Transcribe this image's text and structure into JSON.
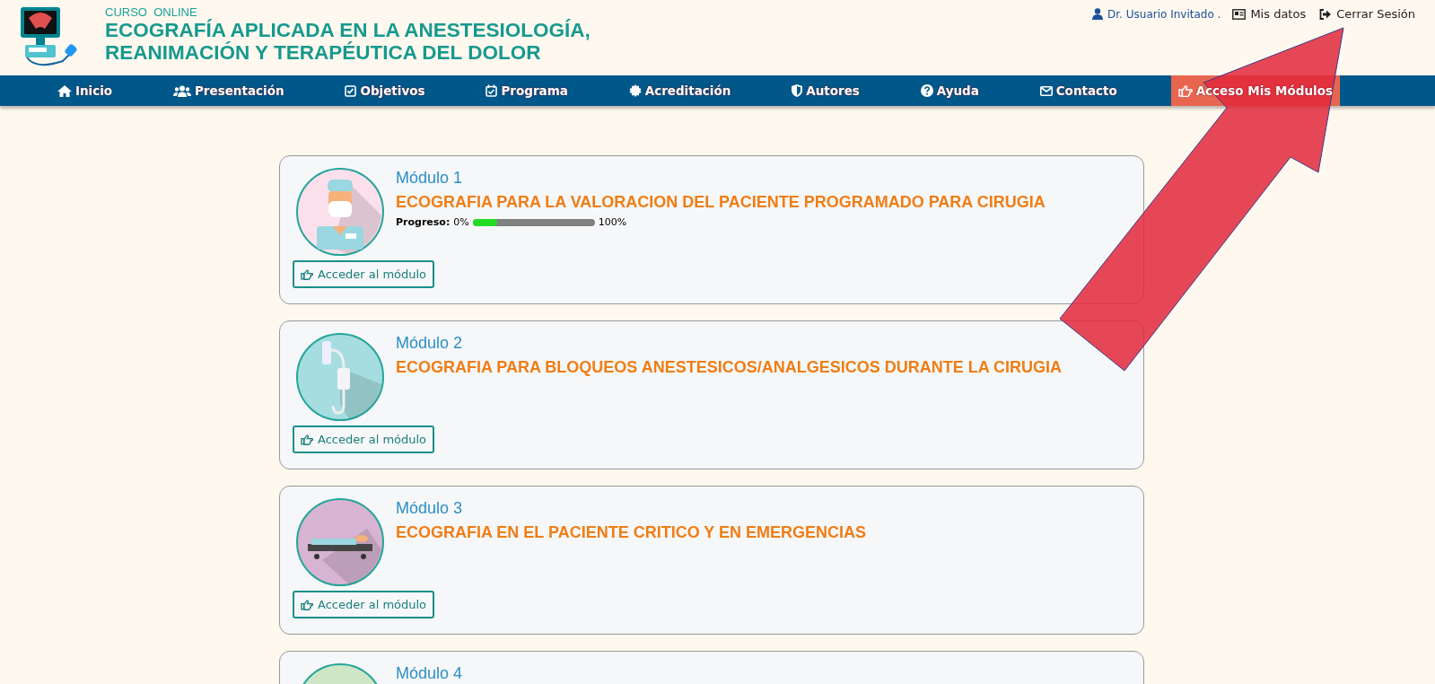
{
  "header": {
    "eyebrow": "CURSO  ONLINE",
    "title_line_1": "ECOGRAFÍA APLICADA EN LA ANESTESIOLOGÍA,",
    "title_line_2": "REANIMACIÓN Y TERAPÉUTICA DEL DOLOR"
  },
  "user_menu": {
    "user": "Dr. Usuario Invitado .",
    "links": [
      "Mis datos",
      "Cerrar Sesión"
    ]
  },
  "nav": [
    {
      "label": "Inicio",
      "selected": false
    },
    {
      "label": "Presentación",
      "selected": false
    },
    {
      "label": "Objetivos",
      "selected": false
    },
    {
      "label": "Programa",
      "selected": false
    },
    {
      "label": "Acreditación",
      "selected": false
    },
    {
      "label": "Autores",
      "selected": false
    },
    {
      "label": "Ayuda",
      "selected": false
    },
    {
      "label": "Contacto",
      "selected": false
    },
    {
      "label": "Acceso Mis Módulos",
      "selected": true
    }
  ],
  "modules": [
    {
      "label": "Módulo 1",
      "title": "ECOGRAFIA PARA LA VALORACION DEL PACIENTE PROGRAMADO PARA CIRUGIA",
      "color": "#fbe0ec",
      "progress": {
        "label": "Progreso:",
        "start": "0%",
        "end": "100%",
        "level": 0.2
      },
      "button": "Acceder al módulo"
    },
    {
      "label": "Módulo 2",
      "title": "ECOGRAFIA PARA BLOQUEOS ANESTESICOS/ANALGESICOS DURANTE LA CIRUGIA",
      "color": "#a6dde0",
      "button": "Acceder al módulo"
    },
    {
      "label": "Módulo 3",
      "title": "ECOGRAFIA EN EL PACIENTE CRITICO Y EN EMERGENCIAS",
      "color": "#d7b4d2",
      "button": "Acceder al módulo"
    },
    {
      "label": "Módulo 4",
      "color": "#cfe6c6"
    }
  ]
}
